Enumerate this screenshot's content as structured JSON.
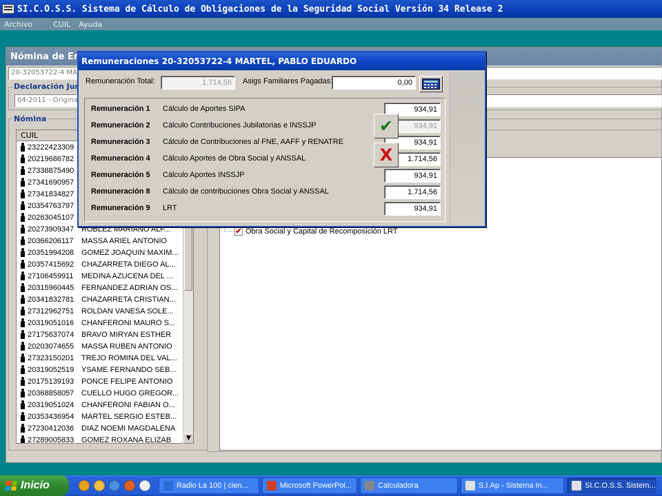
{
  "app": {
    "title": "SI.C.O.S.S. Sistema de Cálculo de Obligaciones de la Seguridad Social Versión 34 Release 2",
    "menu": [
      "Archivo",
      "CUIL",
      "Ayuda"
    ]
  },
  "nomina": {
    "title": "Nómina de Emp",
    "empleado_field": "20-32053722-4  MA",
    "declaracion_label": "Declaración Jura",
    "declaracion_field": "04-2011 - Original",
    "nomina_label": "Nómina",
    "list_header": "CUIL",
    "rows": [
      {
        "cuil": "23222423309",
        "name": ""
      },
      {
        "cuil": "20219686782",
        "name": ""
      },
      {
        "cuil": "27338875490",
        "name": ""
      },
      {
        "cuil": "27341690957",
        "name": ""
      },
      {
        "cuil": "27341834827",
        "name": ""
      },
      {
        "cuil": "20354763797",
        "name": ""
      },
      {
        "cuil": "20263045107",
        "name": ""
      },
      {
        "cuil": "20273909347",
        "name": "ROBLEZ  MARIANO ALF..."
      },
      {
        "cuil": "20366206117",
        "name": "MASSA ARIEL ANTONIO"
      },
      {
        "cuil": "20351994208",
        "name": "GOMEZ JOAQUIN MAXIM..."
      },
      {
        "cuil": "20357415692",
        "name": "CHAZARRETA DIEGO AL..."
      },
      {
        "cuil": "27106459911",
        "name": "MEDINA AZUCENA DEL ..."
      },
      {
        "cuil": "20315960445",
        "name": "FERNANDEZ ADRIAN OS..."
      },
      {
        "cuil": "20341832781",
        "name": "CHAZARRETA CRISTIAN..."
      },
      {
        "cuil": "27312962751",
        "name": "ROLDAN VANESA SOLE..."
      },
      {
        "cuil": "20319051016",
        "name": "CHANFERONI MAURO S..."
      },
      {
        "cuil": "27175637074",
        "name": "BRAVO MIRYAN ESTHER"
      },
      {
        "cuil": "20203074655",
        "name": "MASSA RUBEN ANTONIO"
      },
      {
        "cuil": "27323150201",
        "name": "TREJO ROMINA DEL VAL..."
      },
      {
        "cuil": "20319052519",
        "name": "YSAME FERNANDO SEB..."
      },
      {
        "cuil": "20175139193",
        "name": "PONCE FELIPE ANTONIO"
      },
      {
        "cuil": "20368858057",
        "name": "CUELLO HUGO GREGOR..."
      },
      {
        "cuil": "20319051024",
        "name": "CHANFERONI FABIAN O..."
      },
      {
        "cuil": "20353436954",
        "name": "MARTEL SERGIO ESTEB..."
      },
      {
        "cuil": "27230412036",
        "name": "DIAZ NOEMI MAGDALENA"
      },
      {
        "cuil": "27289005833",
        "name": "GOMEZ ROXANA ELIZAB"
      }
    ],
    "tree_item": "Obra Social y Capital de Recomposición LRT"
  },
  "dialog": {
    "title": "Remuneraciones  20-32053722-4   MARTEL, PABLO EDUARDO",
    "rem_total_label": "Remuneración Total:",
    "rem_total_value": "1.714,56",
    "asigs_label": "Asigs Familiares Pagadas:",
    "asigs_value": "0,00",
    "remuneraciones": [
      {
        "name": "Remuneración 1",
        "desc": "Cálculo de Aportes SIPA",
        "value": "934,91",
        "disabled": false
      },
      {
        "name": "Remuneración 2",
        "desc": "Cálculo Contribuciones Jubilatorias e INSSJP",
        "value": "934,91",
        "disabled": true
      },
      {
        "name": "Remuneración 3",
        "desc": "Cálculo de Contribuciones al FNE, AAFF y RENATRE",
        "value": "934,91",
        "disabled": false
      },
      {
        "name": "Remuneración 4",
        "desc": "Cálculo Aportes de Obra Social y ANSSAL",
        "value": "1.714,56",
        "disabled": false
      },
      {
        "name": "Remuneración 5",
        "desc": "Cálculo Aportes INSSJP",
        "value": "934,91",
        "disabled": false
      },
      {
        "name": "Remuneración 8",
        "desc": "Cálculo de contribuciones Obra Social y ANSSAL",
        "value": "1.714,56",
        "disabled": false
      },
      {
        "name": "Remuneración 9",
        "desc": "LRT",
        "value": "934,91",
        "disabled": false
      }
    ],
    "ok_glyph": "✔",
    "cancel_glyph": "X"
  },
  "taskbar": {
    "start_label": "Inicio",
    "tasks": [
      {
        "label": "Radio La 100 | cien...",
        "icon_color": "#2a6fd8"
      },
      {
        "label": "Microsoft PowerPoi...",
        "icon_color": "#d04020"
      },
      {
        "label": "Calculadora",
        "icon_color": "#888888"
      },
      {
        "label": "S.I.Ap - Sistema In...",
        "icon_color": "#e0e0e0"
      },
      {
        "label": "SI.C.O.S.S. Sistem...",
        "icon_color": "#e0e0e0"
      }
    ]
  },
  "colors": {
    "titlebar_blue": "#0a3fb8",
    "desktop_teal": "#008080",
    "ok_green": "#1a7a1a",
    "cancel_red": "#d01010"
  }
}
